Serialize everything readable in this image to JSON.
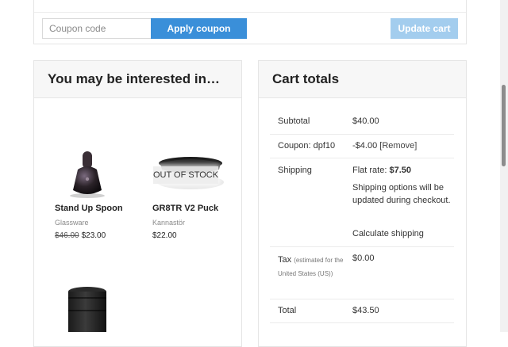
{
  "coupon": {
    "placeholder": "Coupon code",
    "apply_label": "Apply coupon",
    "update_label": "Update cart"
  },
  "interested": {
    "title": "You may be interested in…",
    "products": [
      {
        "name": "Stand Up Spoon",
        "brand": "Glassware",
        "old_price": "$46.00",
        "price": "$23.00",
        "badge": ""
      },
      {
        "name": "GR8TR V2 Puck",
        "brand": "Kannastör",
        "old_price": "",
        "price": "$22.00",
        "badge": "OUT OF STOCK"
      },
      {
        "name": "",
        "brand": "",
        "old_price": "",
        "price": "",
        "badge": ""
      }
    ]
  },
  "totals": {
    "title": "Cart totals",
    "rows": {
      "subtotal": {
        "label": "Subtotal",
        "value": "$40.00"
      },
      "coupon": {
        "label": "Coupon: dpf10",
        "value": "-$4.00",
        "remove": "[Remove]"
      },
      "shipping": {
        "label": "Shipping",
        "rate_prefix": "Flat rate: ",
        "rate_value": "$7.50",
        "note": "Shipping options will be updated during checkout.",
        "calculate": "Calculate shipping"
      },
      "tax": {
        "label": "Tax",
        "note": "(estimated for the United States (US))",
        "value": "$0.00"
      },
      "total": {
        "label": "Total",
        "value": "$43.50"
      }
    }
  }
}
